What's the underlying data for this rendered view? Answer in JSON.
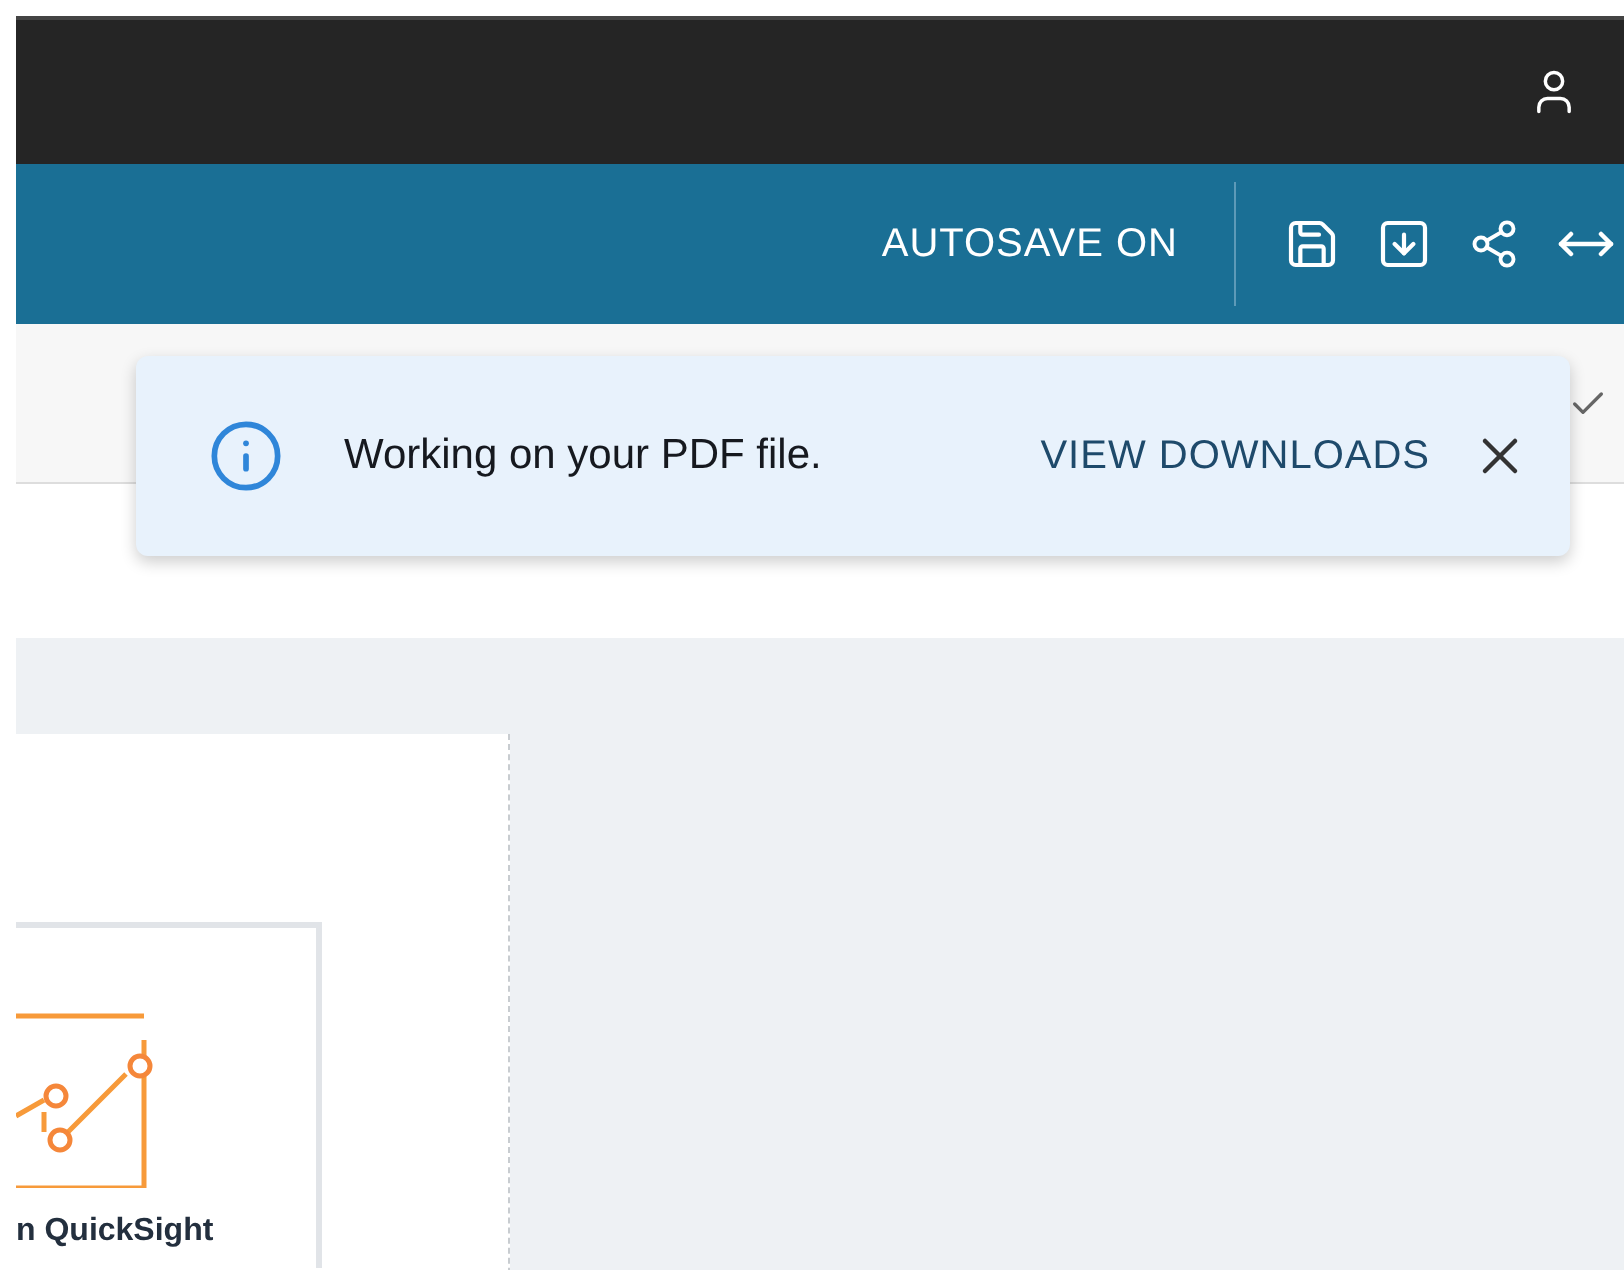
{
  "header": {
    "autosave": "AUTOSAVE ON"
  },
  "notification": {
    "message": "Working on your PDF file.",
    "action": "VIEW DOWNLOADS"
  },
  "card": {
    "title": "n QuickSight"
  }
}
